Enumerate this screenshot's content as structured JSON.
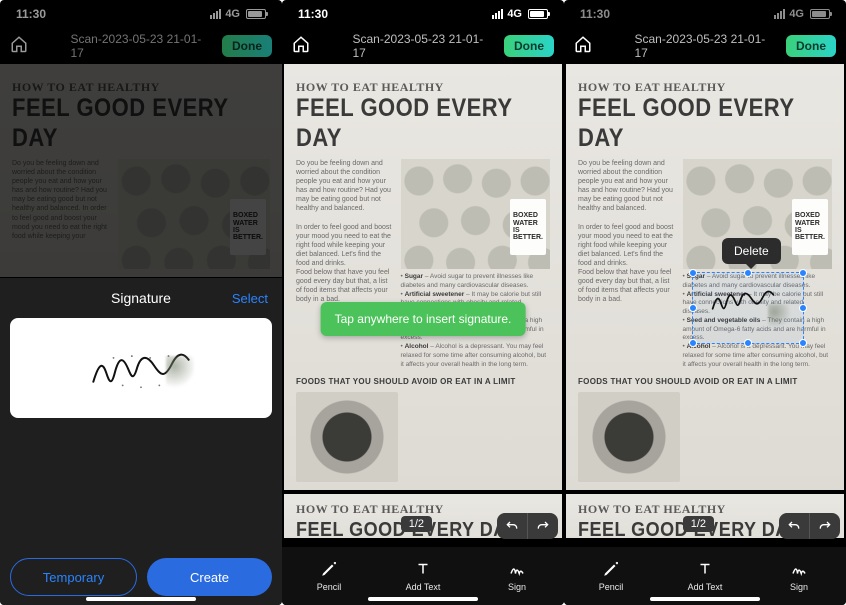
{
  "status": {
    "time": "11:30",
    "network": "4G"
  },
  "nav": {
    "title": "Scan-2023-05-23 21-01-17",
    "done": "Done"
  },
  "document": {
    "eyebrow": "HOW TO EAT HEALTHY",
    "headline": "FEEL GOOD EVERY DAY",
    "box_label_line1": "BOXED",
    "box_label_line2": "WATER",
    "box_label_line3": "IS",
    "box_label_line4": "BETTER.",
    "subheading": "FOODS THAT YOU SHOULD AVOID OR EAT IN A LIMIT",
    "bullet1": "Sugar",
    "bullet2": "Artificial sweetener",
    "bullet3": "Seed and vegetable oils",
    "bullet4": "Alcohol"
  },
  "signature_sheet": {
    "title": "Signature",
    "select": "Select",
    "temporary": "Temporary",
    "create": "Create"
  },
  "toast": {
    "insert_signature": "Tap anywhere to insert signature."
  },
  "pager": {
    "label": "1/2"
  },
  "toolbar": {
    "pencil": "Pencil",
    "add_text": "Add Text",
    "sign": "Sign"
  },
  "popover": {
    "delete": "Delete"
  }
}
